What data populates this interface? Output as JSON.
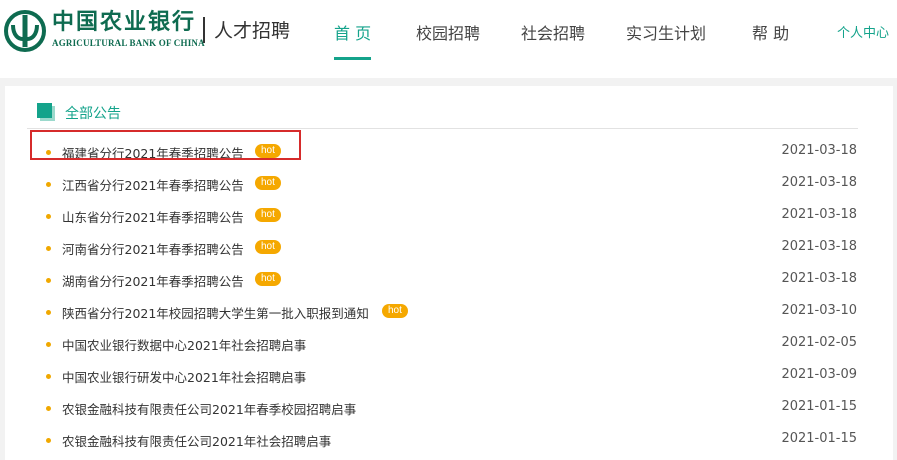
{
  "brand": {
    "name_cn": "中国农业银行",
    "name_en": "AGRICULTURAL BANK OF CHINA",
    "subtitle": "人才招聘"
  },
  "nav": {
    "items": [
      {
        "label": "首 页",
        "active": true
      },
      {
        "label": "校园招聘",
        "active": false
      },
      {
        "label": "社会招聘",
        "active": false
      },
      {
        "label": "实习生计划",
        "active": false
      },
      {
        "label": "帮 助",
        "active": false
      }
    ],
    "personal_center": "个人中心"
  },
  "section": {
    "title": "全部公告"
  },
  "announcements": [
    {
      "title": "福建省分行2021年春季招聘公告",
      "hot": "hot",
      "date": "2021-03-18"
    },
    {
      "title": "江西省分行2021年春季招聘公告",
      "hot": "hot",
      "date": "2021-03-18"
    },
    {
      "title": "山东省分行2021年春季招聘公告",
      "hot": "hot",
      "date": "2021-03-18"
    },
    {
      "title": "河南省分行2021年春季招聘公告",
      "hot": "hot",
      "date": "2021-03-18"
    },
    {
      "title": "湖南省分行2021年春季招聘公告",
      "hot": "hot",
      "date": "2021-03-18"
    },
    {
      "title": "陕西省分行2021年校园招聘大学生第一批入职报到通知",
      "hot": "hot",
      "date": "2021-03-10"
    },
    {
      "title": "中国农业银行数据中心2021年社会招聘启事",
      "hot": null,
      "date": "2021-02-05"
    },
    {
      "title": "中国农业银行研发中心2021年社会招聘启事",
      "hot": null,
      "date": "2021-03-09"
    },
    {
      "title": "农银金融科技有限责任公司2021年春季校园招聘启事",
      "hot": null,
      "date": "2021-01-15"
    },
    {
      "title": "农银金融科技有限责任公司2021年社会招聘启事",
      "hot": null,
      "date": "2021-01-15"
    }
  ],
  "colors": {
    "accent": "#14a38b",
    "brand": "#0e6b50",
    "hot_badge": "#f5a800",
    "highlight": "#d62b2b"
  },
  "icons": {
    "logo": "abc-bank-logo-icon",
    "section": "square-icon",
    "bullet": "bullet-dot-icon"
  }
}
